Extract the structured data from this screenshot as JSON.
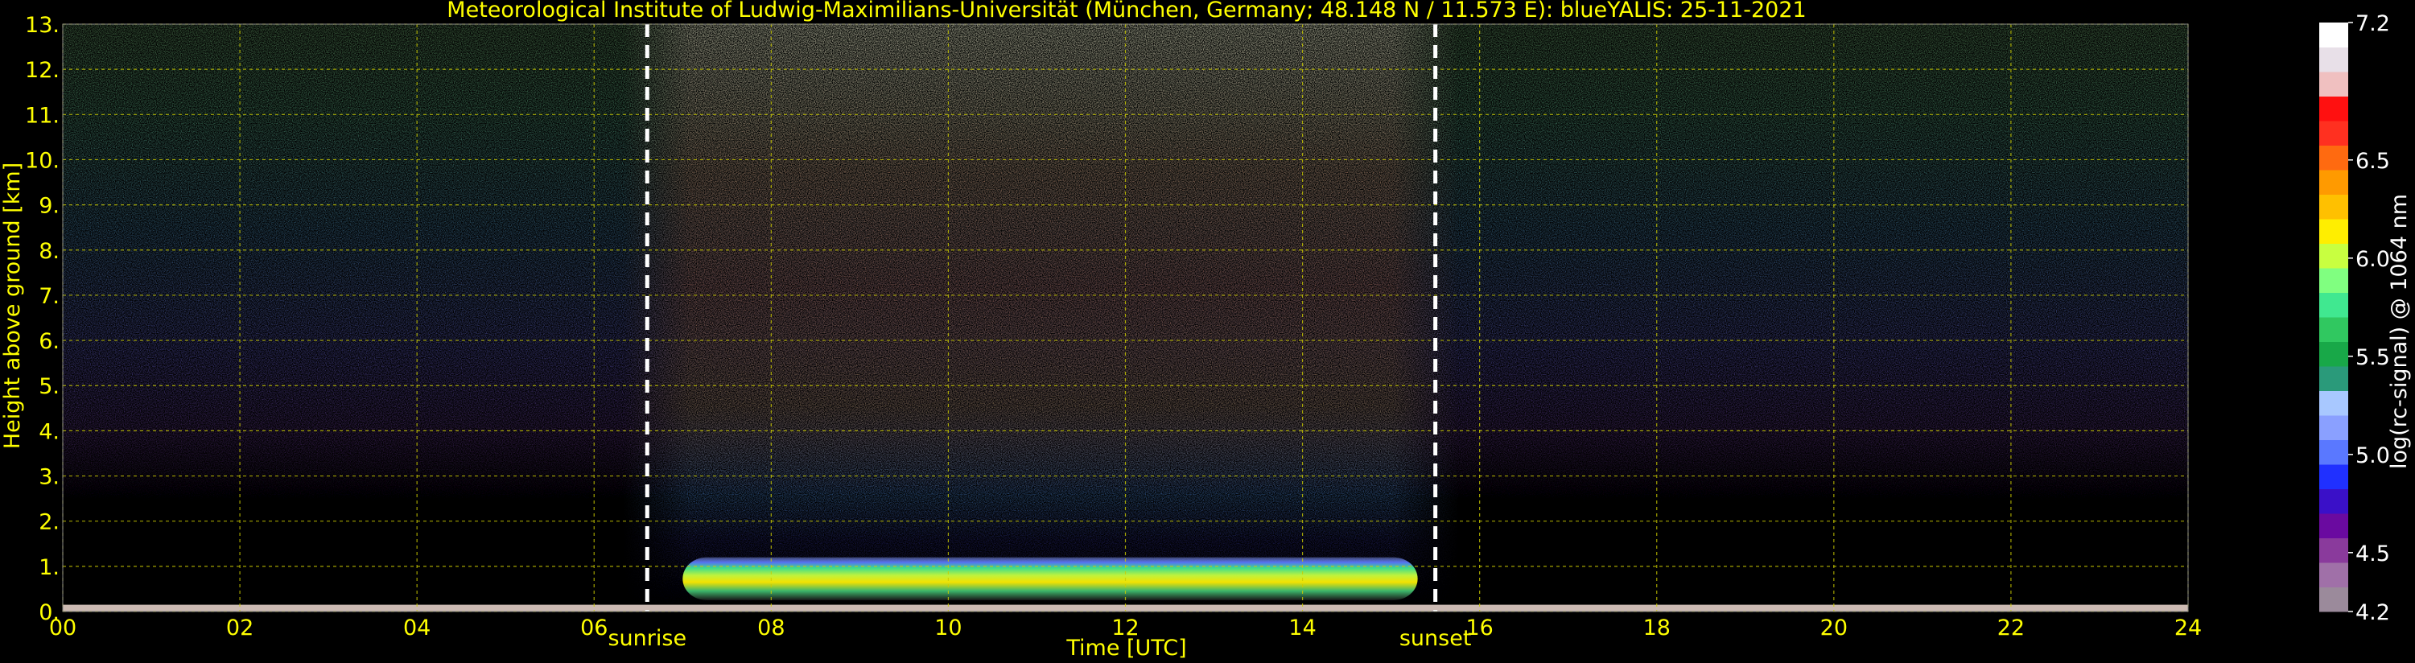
{
  "chart_data": {
    "type": "heatmap",
    "title": "Meteorological Institute of Ludwig-Maximilians-Universität (München, Germany; 48.148 N / 11.573 E):    blueYALIS: 25-11-2021",
    "xlabel": "Time [UTC]",
    "ylabel": "Height above ground [km]",
    "xlim": [
      0,
      24
    ],
    "ylim": [
      0,
      13
    ],
    "x_ticks": [
      "00",
      "02",
      "04",
      "06",
      "08",
      "10",
      "12",
      "14",
      "16",
      "18",
      "20",
      "22",
      "24"
    ],
    "y_ticks": [
      "0.",
      "1.",
      "2.",
      "3.",
      "4.",
      "5.",
      "6.",
      "7.",
      "8.",
      "9.",
      "10.",
      "11.",
      "12.",
      "13."
    ],
    "grid": true,
    "markers": [
      {
        "label": "sunrise",
        "x": 6.6
      },
      {
        "label": "sunset",
        "x": 15.5
      }
    ],
    "colorbar": {
      "label": "log(rc-signal) @ 1064 nm",
      "range": [
        4.2,
        7.2
      ],
      "tick_labels": [
        "4.2",
        "4.5",
        "5.0",
        "5.5",
        "6.0",
        "6.5",
        "7.2"
      ],
      "tick_values": [
        4.2,
        4.5,
        5.0,
        5.5,
        6.0,
        6.5,
        7.2
      ],
      "colors": [
        "#9b8a9b",
        "#a070a8",
        "#8a3a9c",
        "#6a0aa0",
        "#3a10c8",
        "#2030ff",
        "#5a78ff",
        "#8aa0ff",
        "#a8c8ff",
        "#2a9a7a",
        "#18a848",
        "#30c860",
        "#40e890",
        "#80ff80",
        "#c8ff40",
        "#ffee00",
        "#ffc000",
        "#ff9a00",
        "#ff6a10",
        "#ff3020",
        "#ff1010",
        "#f0c0c0",
        "#e8e0e8",
        "#ffffff"
      ]
    },
    "boundary_layer": {
      "top_km": 1.2,
      "start_utc": 7.0,
      "end_utc": 15.3
    }
  },
  "colors": {
    "background": "#000000",
    "text": "#ffff00",
    "grid": "#cccc00",
    "marker_line": "#ffffff",
    "colorbar_text": "#ffffff"
  }
}
